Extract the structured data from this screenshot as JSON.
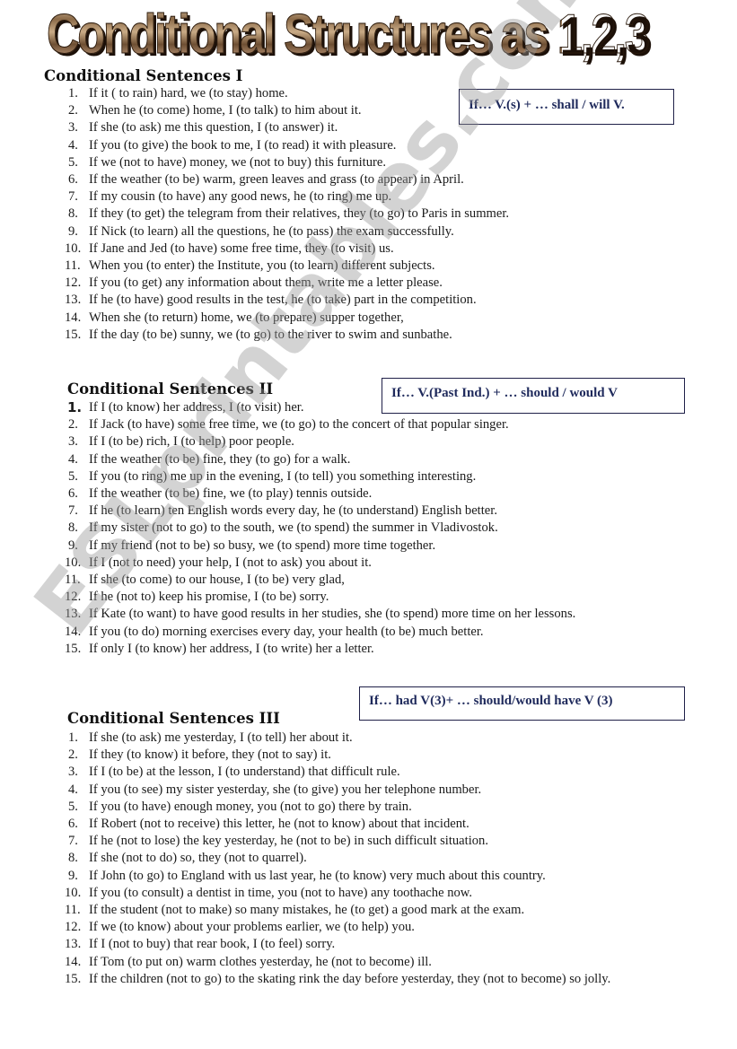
{
  "title": "Conditional Structures as 1,2,3",
  "watermark": "ESLprintables.com",
  "colors": {
    "formula_text": "#1f2a5c",
    "formula_border": "#1f2048",
    "watermark": "#969696",
    "title_brown": "#8b6a48"
  },
  "sections": [
    {
      "heading": "Conditional Sentences I",
      "formula": "If… V.(s)  +  …  shall / will V.",
      "items": [
        {
          "num": "1.",
          "text": "If it ( to rain) hard, we (to stay) home."
        },
        {
          "num": "2.",
          "text": "When he (to come) home, I (to talk) to him about it."
        },
        {
          "num": "3.",
          "text": "If she (to ask) me this question, I (to answer) it."
        },
        {
          "num": "4.",
          "text": "If you (to give) the book to me, I (to read) it with pleasure."
        },
        {
          "num": "5.",
          "text": "If we (not to have) money, we (not to buy) this furniture."
        },
        {
          "num": "6.",
          "text": "If the weather (to be) warm, green leaves and grass (to appear) in April."
        },
        {
          "num": "7.",
          "text": "If my cousin (to have) any good news, he (to ring) me up."
        },
        {
          "num": "8.",
          "text": "If they (to get) the telegram from their relatives, they (to go) to Paris in summer."
        },
        {
          "num": "9.",
          "text": "If Nick (to learn) all the questions, he (to pass) the exam successfully."
        },
        {
          "num": "10.",
          "text": "If Jane and Jed (to have) some free time, they (to visit) us."
        },
        {
          "num": "11.",
          "text": "When you (to enter) the Institute, you (to learn) different subjects."
        },
        {
          "num": "12.",
          "text": "If you (to get) any information about them, write me a letter please."
        },
        {
          "num": "13.",
          "text": "If he (to have) good results in the test, he (to take) part in the competition."
        },
        {
          "num": "14.",
          "text": "When she (to return) home, we (to prepare) supper together,"
        },
        {
          "num": "15.",
          "text": "If the day (to be) sunny, we (to go) to the river to swim and sunbathe."
        }
      ]
    },
    {
      "heading": "Conditional Sentences II",
      "formula": "If… V.(Past Ind.)  +  …  should / would V",
      "items": [
        {
          "num": "1.",
          "text": "If I (to know) her address, I (to visit) her."
        },
        {
          "num": "2.",
          "text": "If Jack (to have) some free time, we (to go) to the concert of that popular singer."
        },
        {
          "num": "3.",
          "text": "If I (to be) rich, I (to help) poor people."
        },
        {
          "num": "4.",
          "text": "If the weather (to be) fine, they (to go) for a walk."
        },
        {
          "num": "5.",
          "text": "If you (to ring) me up in the evening, I (to tell) you something interesting."
        },
        {
          "num": "6.",
          "text": "If the weather (to be) fine, we (to play)  tennis  outside."
        },
        {
          "num": "7.",
          "text": "If he (to learn) ten English words every day, he (to understand) English better."
        },
        {
          "num": "8.",
          "text": "If my sister (not to go) to the south, we (to spend) the summer in Vladivostok."
        },
        {
          "num": "9.",
          "text": "If my friend (not to be) so busy, we (to spend) more time together."
        },
        {
          "num": "10.",
          "text": "If I (not to need) your help, I (not to ask) you about it."
        },
        {
          "num": "11.",
          "text": "If she (to come) to our house, I (to be) very glad,"
        },
        {
          "num": "12.",
          "text": "If he (not to) keep his promise, I (to be) sorry."
        },
        {
          "num": "13.",
          "text": "If Kate (to want) to have good results in her studies, she (to spend) more time on her lessons."
        },
        {
          "num": "14.",
          "text": "If you (to do) morning exercises every day, your health (to be) much better."
        },
        {
          "num": "15.",
          "text": "If only I (to know) her address, I (to write) her a letter."
        }
      ]
    },
    {
      "heading": "Conditional Sentences III",
      "formula": "If… had V(3)+  …  should/would have V (3)",
      "items": [
        {
          "num": "1.",
          "text": "If she (to ask) me yesterday, I (to tell) her about it."
        },
        {
          "num": "2.",
          "text": "If they (to know) it before, they (not to say) it."
        },
        {
          "num": "3.",
          "text": "If I (to be) at the lesson, I (to understand) that difficult rule."
        },
        {
          "num": "4.",
          "text": "If you (to see) my sister yesterday, she (to give) you her telephone number."
        },
        {
          "num": "5.",
          "text": "If you (to have) enough money, you (not to go) there by train."
        },
        {
          "num": "6.",
          "text": "If Robert (not to receive) this letter, he (not to know) about  that incident."
        },
        {
          "num": "7.",
          "text": "If he (not to lose) the key yesterday, he (not to be) in such difficult situation."
        },
        {
          "num": "8.",
          "text": "If she (not to do) so, they (not to quarrel)."
        },
        {
          "num": "9.",
          "text": "If John (to go) to England with us last year, he (to know) very much about this country."
        },
        {
          "num": "10.",
          "text": "If you (to consult) a dentist in time, you (not to have) any toothache now."
        },
        {
          "num": "11.",
          "text": "If the student (not to make) so many mistakes, he (to get) a good mark at the exam."
        },
        {
          "num": "12.",
          "text": "If we (to know) about your problems earlier, we (to help) you."
        },
        {
          "num": "13.",
          "text": "If I (not to buy) that rear book, I (to feel) sorry."
        },
        {
          "num": "14.",
          "text": "If Tom (to put on) warm clothes yesterday, he (not to become) ill."
        },
        {
          "num": "15.",
          "text": "If the children (not to go) to the skating rink the day before yesterday, they (not to become) so jolly."
        }
      ]
    }
  ]
}
